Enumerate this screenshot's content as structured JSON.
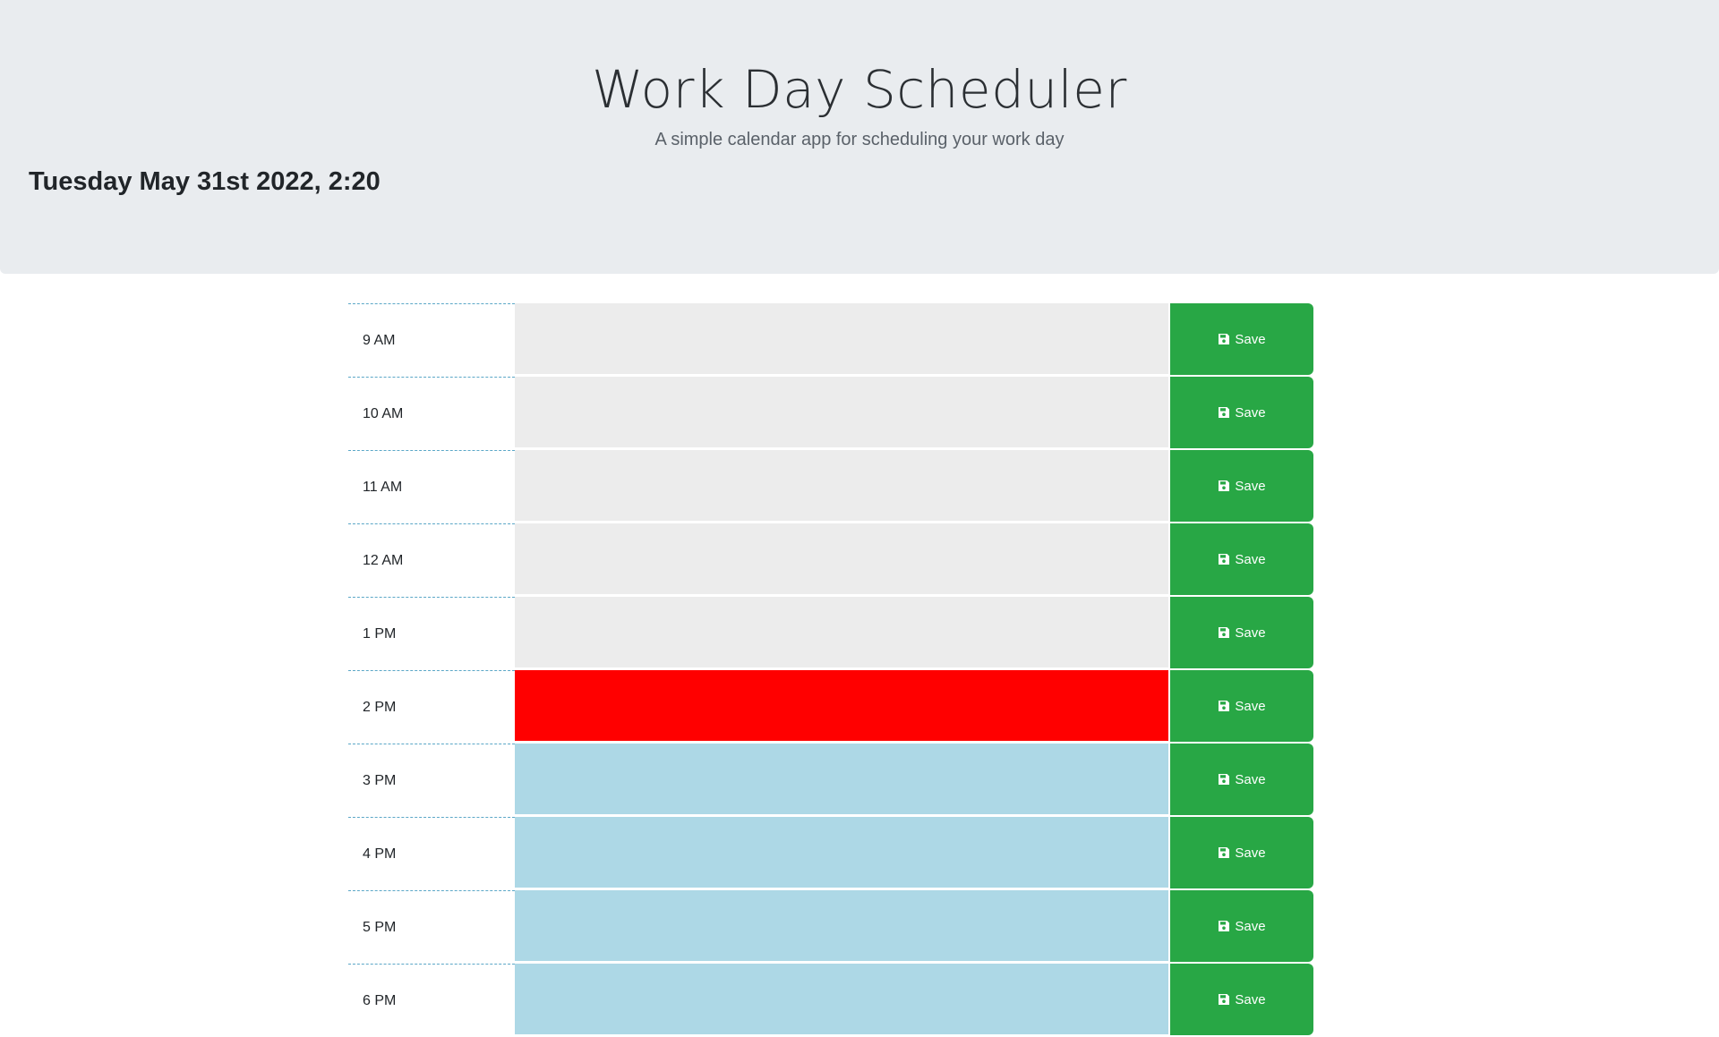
{
  "header": {
    "title": "Work Day Scheduler",
    "subtitle": "A simple calendar app for scheduling your work day",
    "current_day": "Tuesday May 31st 2022, 2:20"
  },
  "colors": {
    "past": "#ececec",
    "present": "#ff0000",
    "future": "#add8e6",
    "save_button": "#28a745"
  },
  "schedule": {
    "save_label": "Save",
    "save_icon": "floppy-disk-icon",
    "hours": [
      {
        "label": "9 AM",
        "state": "past",
        "text": ""
      },
      {
        "label": "10 AM",
        "state": "past",
        "text": ""
      },
      {
        "label": "11 AM",
        "state": "past",
        "text": ""
      },
      {
        "label": "12 AM",
        "state": "past",
        "text": ""
      },
      {
        "label": "1 PM",
        "state": "past",
        "text": ""
      },
      {
        "label": "2 PM",
        "state": "present",
        "text": ""
      },
      {
        "label": "3 PM",
        "state": "future",
        "text": ""
      },
      {
        "label": "4 PM",
        "state": "future",
        "text": ""
      },
      {
        "label": "5 PM",
        "state": "future",
        "text": ""
      },
      {
        "label": "6 PM",
        "state": "future",
        "text": ""
      }
    ]
  }
}
